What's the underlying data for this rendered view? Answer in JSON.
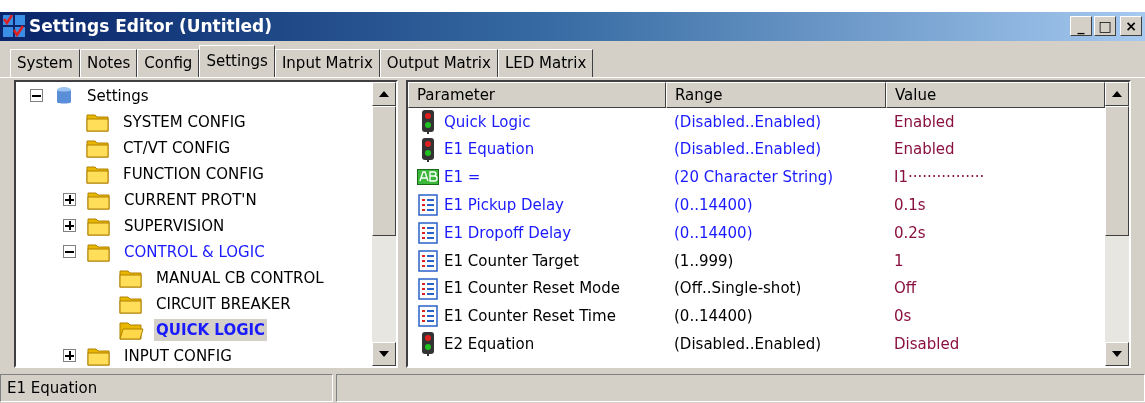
{
  "window": {
    "title": "Settings Editor (Untitled)",
    "controls": [
      "_",
      "□",
      "×"
    ]
  },
  "tabs": [
    {
      "label": "System",
      "selected": false
    },
    {
      "label": "Notes",
      "selected": false
    },
    {
      "label": "Config",
      "selected": false
    },
    {
      "label": "Settings",
      "selected": true
    },
    {
      "label": "Input Matrix",
      "selected": false
    },
    {
      "label": "Output Matrix",
      "selected": false
    },
    {
      "label": "LED Matrix",
      "selected": false
    }
  ],
  "tree": {
    "items": [
      {
        "label": "Settings",
        "kind": "root",
        "expandable": true,
        "expanded": true,
        "selected": false,
        "modified": false,
        "children": [
          {
            "label": "SYSTEM CONFIG",
            "kind": "folder",
            "expandable": false,
            "selected": false,
            "modified": false
          },
          {
            "label": "CT/VT CONFIG",
            "kind": "folder",
            "expandable": false,
            "selected": false,
            "modified": false
          },
          {
            "label": "FUNCTION CONFIG",
            "kind": "folder",
            "expandable": false,
            "selected": false,
            "modified": false
          },
          {
            "label": "CURRENT PROT'N",
            "kind": "folder",
            "expandable": true,
            "expanded": false,
            "selected": false,
            "modified": false
          },
          {
            "label": "SUPERVISION",
            "kind": "folder",
            "expandable": true,
            "expanded": false,
            "selected": false,
            "modified": false
          },
          {
            "label": "CONTROL & LOGIC",
            "kind": "folder",
            "expandable": true,
            "expanded": true,
            "selected": false,
            "modified": true,
            "children": [
              {
                "label": "MANUAL CB CONTROL",
                "kind": "folder",
                "expandable": false,
                "selected": false,
                "modified": false
              },
              {
                "label": "CIRCUIT BREAKER",
                "kind": "folder",
                "expandable": false,
                "selected": false,
                "modified": false
              },
              {
                "label": "QUICK LOGIC",
                "kind": "folder",
                "expandable": false,
                "selected": true,
                "modified": true
              }
            ]
          },
          {
            "label": "INPUT CONFIG",
            "kind": "folder",
            "expandable": true,
            "expanded": false,
            "selected": false,
            "modified": false
          }
        ]
      }
    ]
  },
  "table": {
    "columns": [
      "Parameter",
      "Range",
      "Value"
    ],
    "rows": [
      {
        "kind": "switch",
        "parameter": "Quick Logic",
        "range": "(Disabled..Enabled)",
        "value": "Enabled",
        "modified": true
      },
      {
        "kind": "switch",
        "parameter": "E1 Equation",
        "range": "(Disabled..Enabled)",
        "value": "Enabled",
        "modified": true
      },
      {
        "kind": "text",
        "parameter": "E1 =",
        "range": "(20 Character String)",
        "value": "I1················",
        "modified": true
      },
      {
        "kind": "list",
        "parameter": "E1 Pickup Delay",
        "range": "(0..14400)",
        "value": "0.1s",
        "modified": true
      },
      {
        "kind": "list",
        "parameter": "E1 Dropoff Delay",
        "range": "(0..14400)",
        "value": "0.2s",
        "modified": true
      },
      {
        "kind": "list",
        "parameter": "E1 Counter Target",
        "range": "(1..999)",
        "value": "1",
        "modified": false
      },
      {
        "kind": "list",
        "parameter": "E1 Counter Reset Mode",
        "range": "(Off..Single-shot)",
        "value": "Off",
        "modified": false
      },
      {
        "kind": "list",
        "parameter": "E1 Counter Reset Time",
        "range": "(0..14400)",
        "value": "0s",
        "modified": false
      },
      {
        "kind": "switch",
        "parameter": "E2 Equation",
        "range": "(Disabled..Enabled)",
        "value": "Disabled",
        "modified": false
      }
    ]
  },
  "status_bar": {
    "text": "E1 Equation"
  }
}
